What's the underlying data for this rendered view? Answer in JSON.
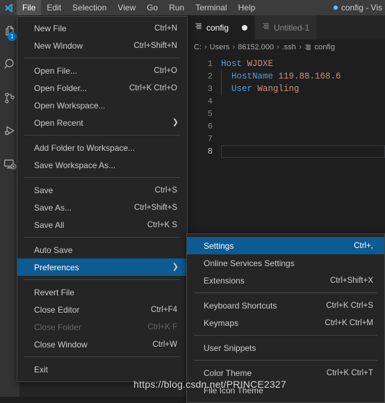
{
  "window": {
    "title": "config - Vis",
    "dirty_indicator": "•"
  },
  "menubar": {
    "items": [
      {
        "label": "File",
        "active": true
      },
      {
        "label": "Edit",
        "active": false
      },
      {
        "label": "Selection",
        "active": false
      },
      {
        "label": "View",
        "active": false
      },
      {
        "label": "Go",
        "active": false
      },
      {
        "label": "Run",
        "active": false
      },
      {
        "label": "Terminal",
        "active": false
      },
      {
        "label": "Help",
        "active": false
      }
    ]
  },
  "activitybar": {
    "items": [
      {
        "name": "explorer-icon",
        "badge": "1"
      },
      {
        "name": "search-icon",
        "badge": ""
      },
      {
        "name": "source-control-icon",
        "badge": ""
      },
      {
        "name": "run-and-debug-icon",
        "badge": ""
      },
      {
        "name": "remote-explorer-icon",
        "badge": ""
      }
    ]
  },
  "file_menu": {
    "items": [
      {
        "label": "New File",
        "kb": "Ctrl+N",
        "type": "item"
      },
      {
        "label": "New Window",
        "kb": "Ctrl+Shift+N",
        "type": "item"
      },
      {
        "type": "separator"
      },
      {
        "label": "Open File...",
        "kb": "Ctrl+O",
        "type": "item"
      },
      {
        "label": "Open Folder...",
        "kb": "Ctrl+K Ctrl+O",
        "type": "item"
      },
      {
        "label": "Open Workspace...",
        "kb": "",
        "type": "item"
      },
      {
        "label": "Open Recent",
        "kb": "",
        "type": "item",
        "submenu": true
      },
      {
        "type": "separator"
      },
      {
        "label": "Add Folder to Workspace...",
        "kb": "",
        "type": "item"
      },
      {
        "label": "Save Workspace As...",
        "kb": "",
        "type": "item"
      },
      {
        "type": "separator"
      },
      {
        "label": "Save",
        "kb": "Ctrl+S",
        "type": "item"
      },
      {
        "label": "Save As...",
        "kb": "Ctrl+Shift+S",
        "type": "item"
      },
      {
        "label": "Save All",
        "kb": "Ctrl+K S",
        "type": "item"
      },
      {
        "type": "separator"
      },
      {
        "label": "Auto Save",
        "kb": "",
        "type": "item"
      },
      {
        "label": "Preferences",
        "kb": "",
        "type": "item",
        "submenu": true,
        "selected": true
      },
      {
        "type": "separator"
      },
      {
        "label": "Revert File",
        "kb": "",
        "type": "item"
      },
      {
        "label": "Close Editor",
        "kb": "Ctrl+F4",
        "type": "item"
      },
      {
        "label": "Close Folder",
        "kb": "Ctrl+K F",
        "type": "item",
        "disabled": true
      },
      {
        "label": "Close Window",
        "kb": "Ctrl+W",
        "type": "item"
      },
      {
        "type": "separator"
      },
      {
        "label": "Exit",
        "kb": "",
        "type": "item"
      }
    ]
  },
  "preferences_submenu": {
    "items": [
      {
        "label": "Settings",
        "kb": "Ctrl+,",
        "type": "item",
        "selected": true
      },
      {
        "label": "Online Services Settings",
        "kb": "",
        "type": "item"
      },
      {
        "label": "Extensions",
        "kb": "Ctrl+Shift+X",
        "type": "item"
      },
      {
        "type": "separator"
      },
      {
        "label": "Keyboard Shortcuts",
        "kb": "Ctrl+K Ctrl+S",
        "type": "item"
      },
      {
        "label": "Keymaps",
        "kb": "Ctrl+K Ctrl+M",
        "type": "item"
      },
      {
        "type": "separator"
      },
      {
        "label": "User Snippets",
        "kb": "",
        "type": "item"
      },
      {
        "type": "separator"
      },
      {
        "label": "Color Theme",
        "kb": "Ctrl+K Ctrl+T",
        "type": "item"
      },
      {
        "label": "File Icon Theme",
        "kb": "",
        "type": "item"
      }
    ]
  },
  "editor": {
    "tabs": [
      {
        "label": "config",
        "active": true,
        "dirty": true
      },
      {
        "label": "Untitled-1",
        "active": false,
        "dirty": false
      }
    ],
    "breadcrumbs": [
      "C:",
      "Users",
      "86152.000",
      ".ssh",
      "config"
    ],
    "breadcrumb_separator": "›",
    "lines": [
      {
        "no": "1",
        "tokens": [
          {
            "t": "Host",
            "c": "key"
          },
          {
            "t": " WJDXE",
            "c": "val"
          }
        ],
        "indent": false,
        "current": false
      },
      {
        "no": "2",
        "tokens": [
          {
            "t": "  HostName",
            "c": "key"
          },
          {
            "t": " 119.88.168.6",
            "c": "val"
          }
        ],
        "indent": true,
        "current": false
      },
      {
        "no": "3",
        "tokens": [
          {
            "t": "  User",
            "c": "key"
          },
          {
            "t": " Wangling",
            "c": "val"
          }
        ],
        "indent": true,
        "current": false
      },
      {
        "no": "4",
        "tokens": [],
        "indent": false,
        "current": false
      },
      {
        "no": "5",
        "tokens": [],
        "indent": false,
        "current": false
      },
      {
        "no": "6",
        "tokens": [],
        "indent": false,
        "current": false
      },
      {
        "no": "7",
        "tokens": [],
        "indent": false,
        "current": false
      },
      {
        "no": "8",
        "tokens": [],
        "indent": false,
        "current": true
      }
    ]
  },
  "watermark": {
    "text": "https://blog.csdn.net/PRINCE2327"
  },
  "colors": {
    "accent": "#007acc",
    "menu_selected": "#0c5b93",
    "titlebar_bg": "#3c3c3c",
    "activitybar_bg": "#333333",
    "sidebar_bg": "#252526",
    "editor_bg": "#1e1e1e",
    "keyword": "#569cd6",
    "string": "#ce9178"
  }
}
